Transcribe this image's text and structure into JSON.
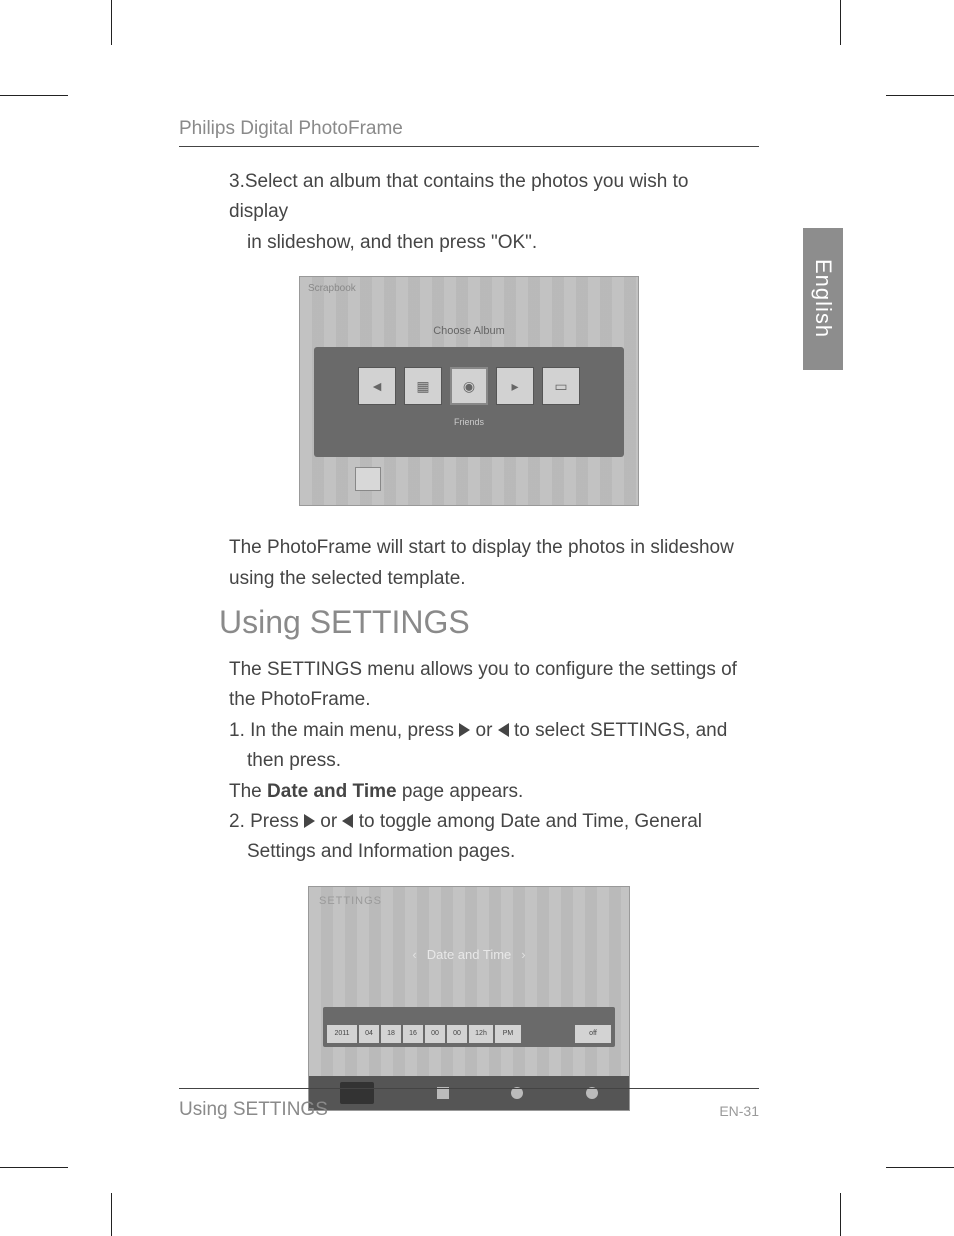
{
  "header": {
    "title": "Philips Digital PhotoFrame"
  },
  "side_tab": {
    "label": "English"
  },
  "step3": {
    "line1": "3.Select an album that contains the photos you wish to display",
    "line2": "in slideshow, and then press \"OK\"."
  },
  "figure1": {
    "tab": "Scrapbook",
    "label": "Choose Album",
    "caption": "Friends"
  },
  "after_fig1": {
    "line1": "The PhotoFrame will start to display the photos in slideshow",
    "line2": "using the selected template."
  },
  "section": {
    "title": "Using SETTINGS"
  },
  "settings_intro": {
    "line1": "The SETTINGS menu allows you to configure the settings of",
    "line2": " the PhotoFrame."
  },
  "step1": {
    "pre": "1. In the main menu, press ",
    "mid": " or ",
    "post": " to select SETTINGS, and",
    "line2": "then press."
  },
  "date_time_line": {
    "pre": "The ",
    "bold": "Date and Time",
    "post": " page appears."
  },
  "step2": {
    "pre": "2. Press ",
    "mid": " or ",
    "post": " to toggle among Date and Time, General",
    "line2": "Settings and Information pages."
  },
  "figure2": {
    "tab": "SETTINGS",
    "title": "Date and Time",
    "cells": [
      "2011",
      "04",
      "18",
      "16",
      "00",
      "00",
      "12h",
      "PM",
      "off"
    ]
  },
  "footer": {
    "section": "Using SETTINGS",
    "page": "EN-31"
  }
}
